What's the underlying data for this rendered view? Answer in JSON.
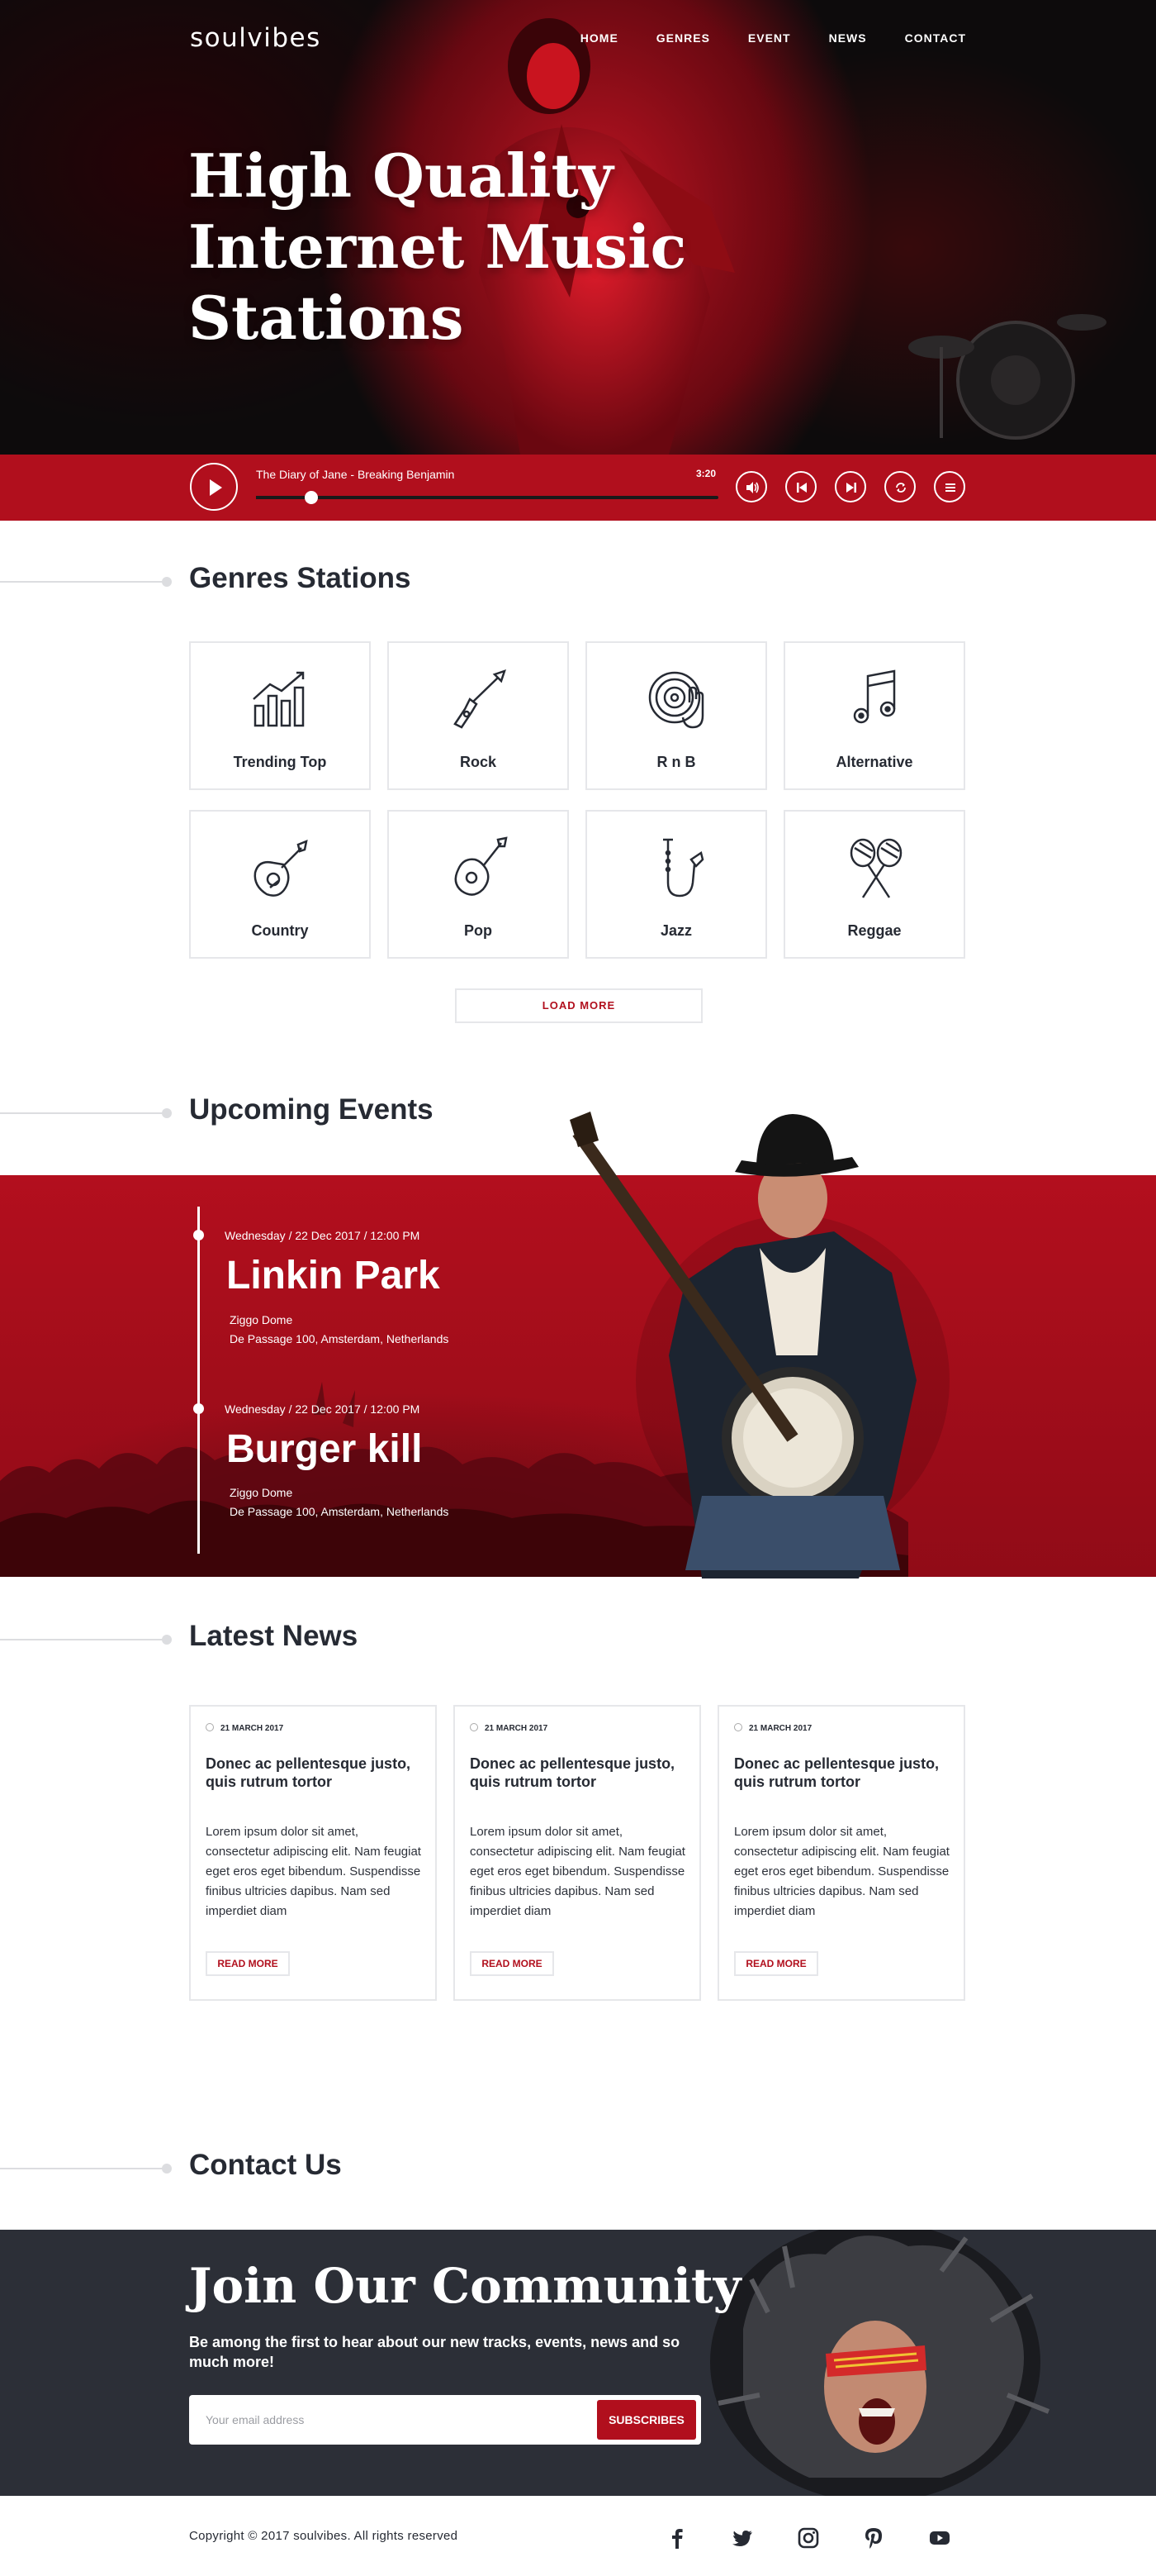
{
  "brand": {
    "logo": "soulvibes",
    "accent": "#b10f1d",
    "dark": "#2c2f37"
  },
  "nav": {
    "items": [
      "HOME",
      "GENRES",
      "EVENT",
      "NEWS",
      "CONTACT"
    ]
  },
  "hero": {
    "title_lines": [
      "High Quality",
      "Internet Music",
      "Stations"
    ]
  },
  "player": {
    "track": "The Diary of Jane - Breaking Benjamin",
    "time": "3:20",
    "progress": 0.12,
    "controls": [
      "volume-icon",
      "previous-icon",
      "next-icon",
      "repeat-icon",
      "playlist-icon"
    ]
  },
  "genres": {
    "title": "Genres Stations",
    "items": [
      {
        "label": "Trending Top",
        "icon": "trending-chart-icon"
      },
      {
        "label": "Rock",
        "icon": "electric-guitar-icon"
      },
      {
        "label": "R n B",
        "icon": "vinyl-hand-icon"
      },
      {
        "label": "Alternative",
        "icon": "music-note-icon"
      },
      {
        "label": "Country",
        "icon": "acoustic-guitar-icon"
      },
      {
        "label": "Pop",
        "icon": "guitar-icon"
      },
      {
        "label": "Jazz",
        "icon": "saxophone-icon"
      },
      {
        "label": "Reggae",
        "icon": "maracas-icon"
      }
    ],
    "load_more": "LOAD MORE"
  },
  "events": {
    "title": "Upcoming Events",
    "items": [
      {
        "meta": "Wednesday  /  22 Dec 2017  /  12:00 PM",
        "name": "Linkin Park",
        "venue": "Ziggo Dome",
        "address": "De Passage 100, Amsterdam, Netherlands"
      },
      {
        "meta": "Wednesday  /  22 Dec 2017  /  12:00 PM",
        "name": "Burger kill",
        "venue": "Ziggo Dome",
        "address": "De Passage 100, Amsterdam, Netherlands"
      }
    ]
  },
  "news": {
    "title": "Latest News",
    "items": [
      {
        "date": "21 MARCH 2017",
        "title": "Donec ac pellentesque justo, quis rutrum tortor",
        "text": "Lorem ipsum dolor sit amet, consectetur adipiscing elit. Nam feugiat eget eros eget bibendum. Suspendisse finibus ultricies dapibus. Nam sed imperdiet diam",
        "cta": "READ MORE"
      },
      {
        "date": "21 MARCH 2017",
        "title": "Donec ac pellentesque justo, quis rutrum tortor",
        "text": "Lorem ipsum dolor sit amet, consectetur adipiscing elit. Nam feugiat eget eros eget bibendum. Suspendisse finibus ultricies dapibus. Nam sed imperdiet diam",
        "cta": "READ MORE"
      },
      {
        "date": "21 MARCH 2017",
        "title": "Donec ac pellentesque justo, quis rutrum tortor",
        "text": "Lorem ipsum dolor sit amet, consectetur adipiscing elit. Nam feugiat eget eros eget bibendum. Suspendisse finibus ultricies dapibus. Nam sed imperdiet diam",
        "cta": "READ MORE"
      }
    ]
  },
  "contact": {
    "title": "Contact Us",
    "join_title": "Join Our Community",
    "join_sub": "Be among the first to hear about our new tracks, events, news and so much more!",
    "email_placeholder": "Your email address",
    "subscribe": "SUBSCRIBES"
  },
  "footer": {
    "copyright": "Copyright © 2017 soulvibes.  All rights reserved",
    "social": [
      "facebook-icon",
      "twitter-icon",
      "instagram-icon",
      "pinterest-icon",
      "youtube-icon"
    ]
  }
}
